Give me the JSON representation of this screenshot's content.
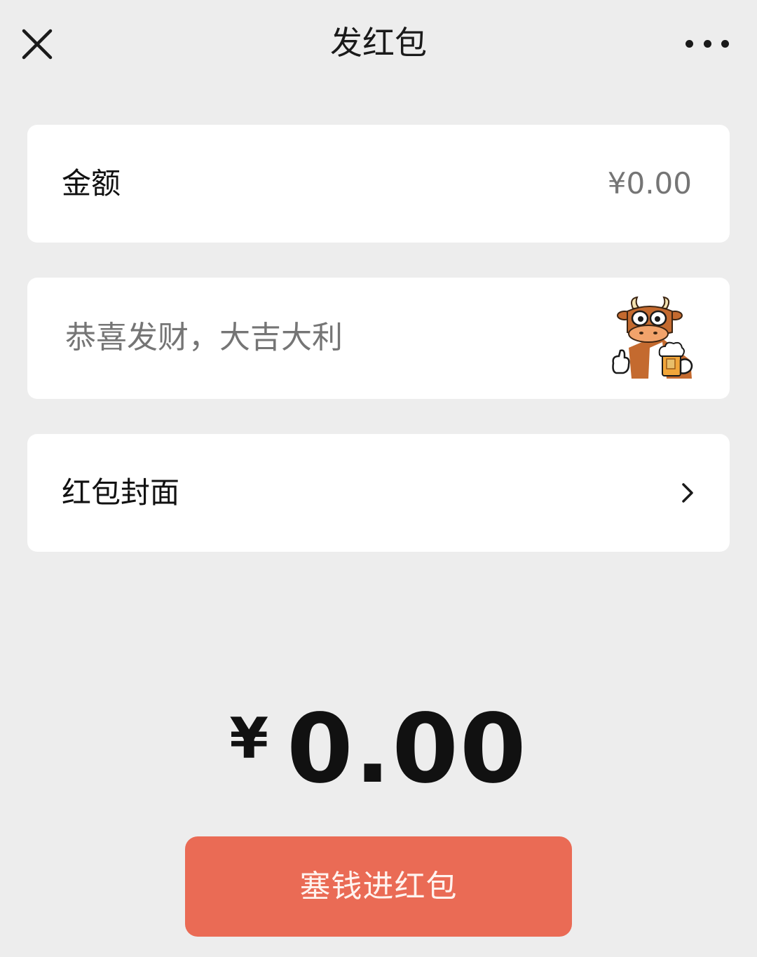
{
  "header": {
    "title": "发红包"
  },
  "amount": {
    "label": "金额",
    "placeholder": "¥0.00"
  },
  "greeting": {
    "placeholder": "恭喜发财，大吉大利"
  },
  "cover": {
    "label": "红包封面"
  },
  "summary": {
    "currency": "¥",
    "value": "0.00"
  },
  "actions": {
    "send_label": "塞钱进红包"
  },
  "colors": {
    "background": "#ededed",
    "card": "#ffffff",
    "accent": "#ea6b55",
    "placeholder": "#b8b8b8"
  },
  "icons": {
    "close": "close-icon",
    "more": "more-icon",
    "emoji": "cow-beer-emoji-icon",
    "chevron": "chevron-right-icon"
  }
}
